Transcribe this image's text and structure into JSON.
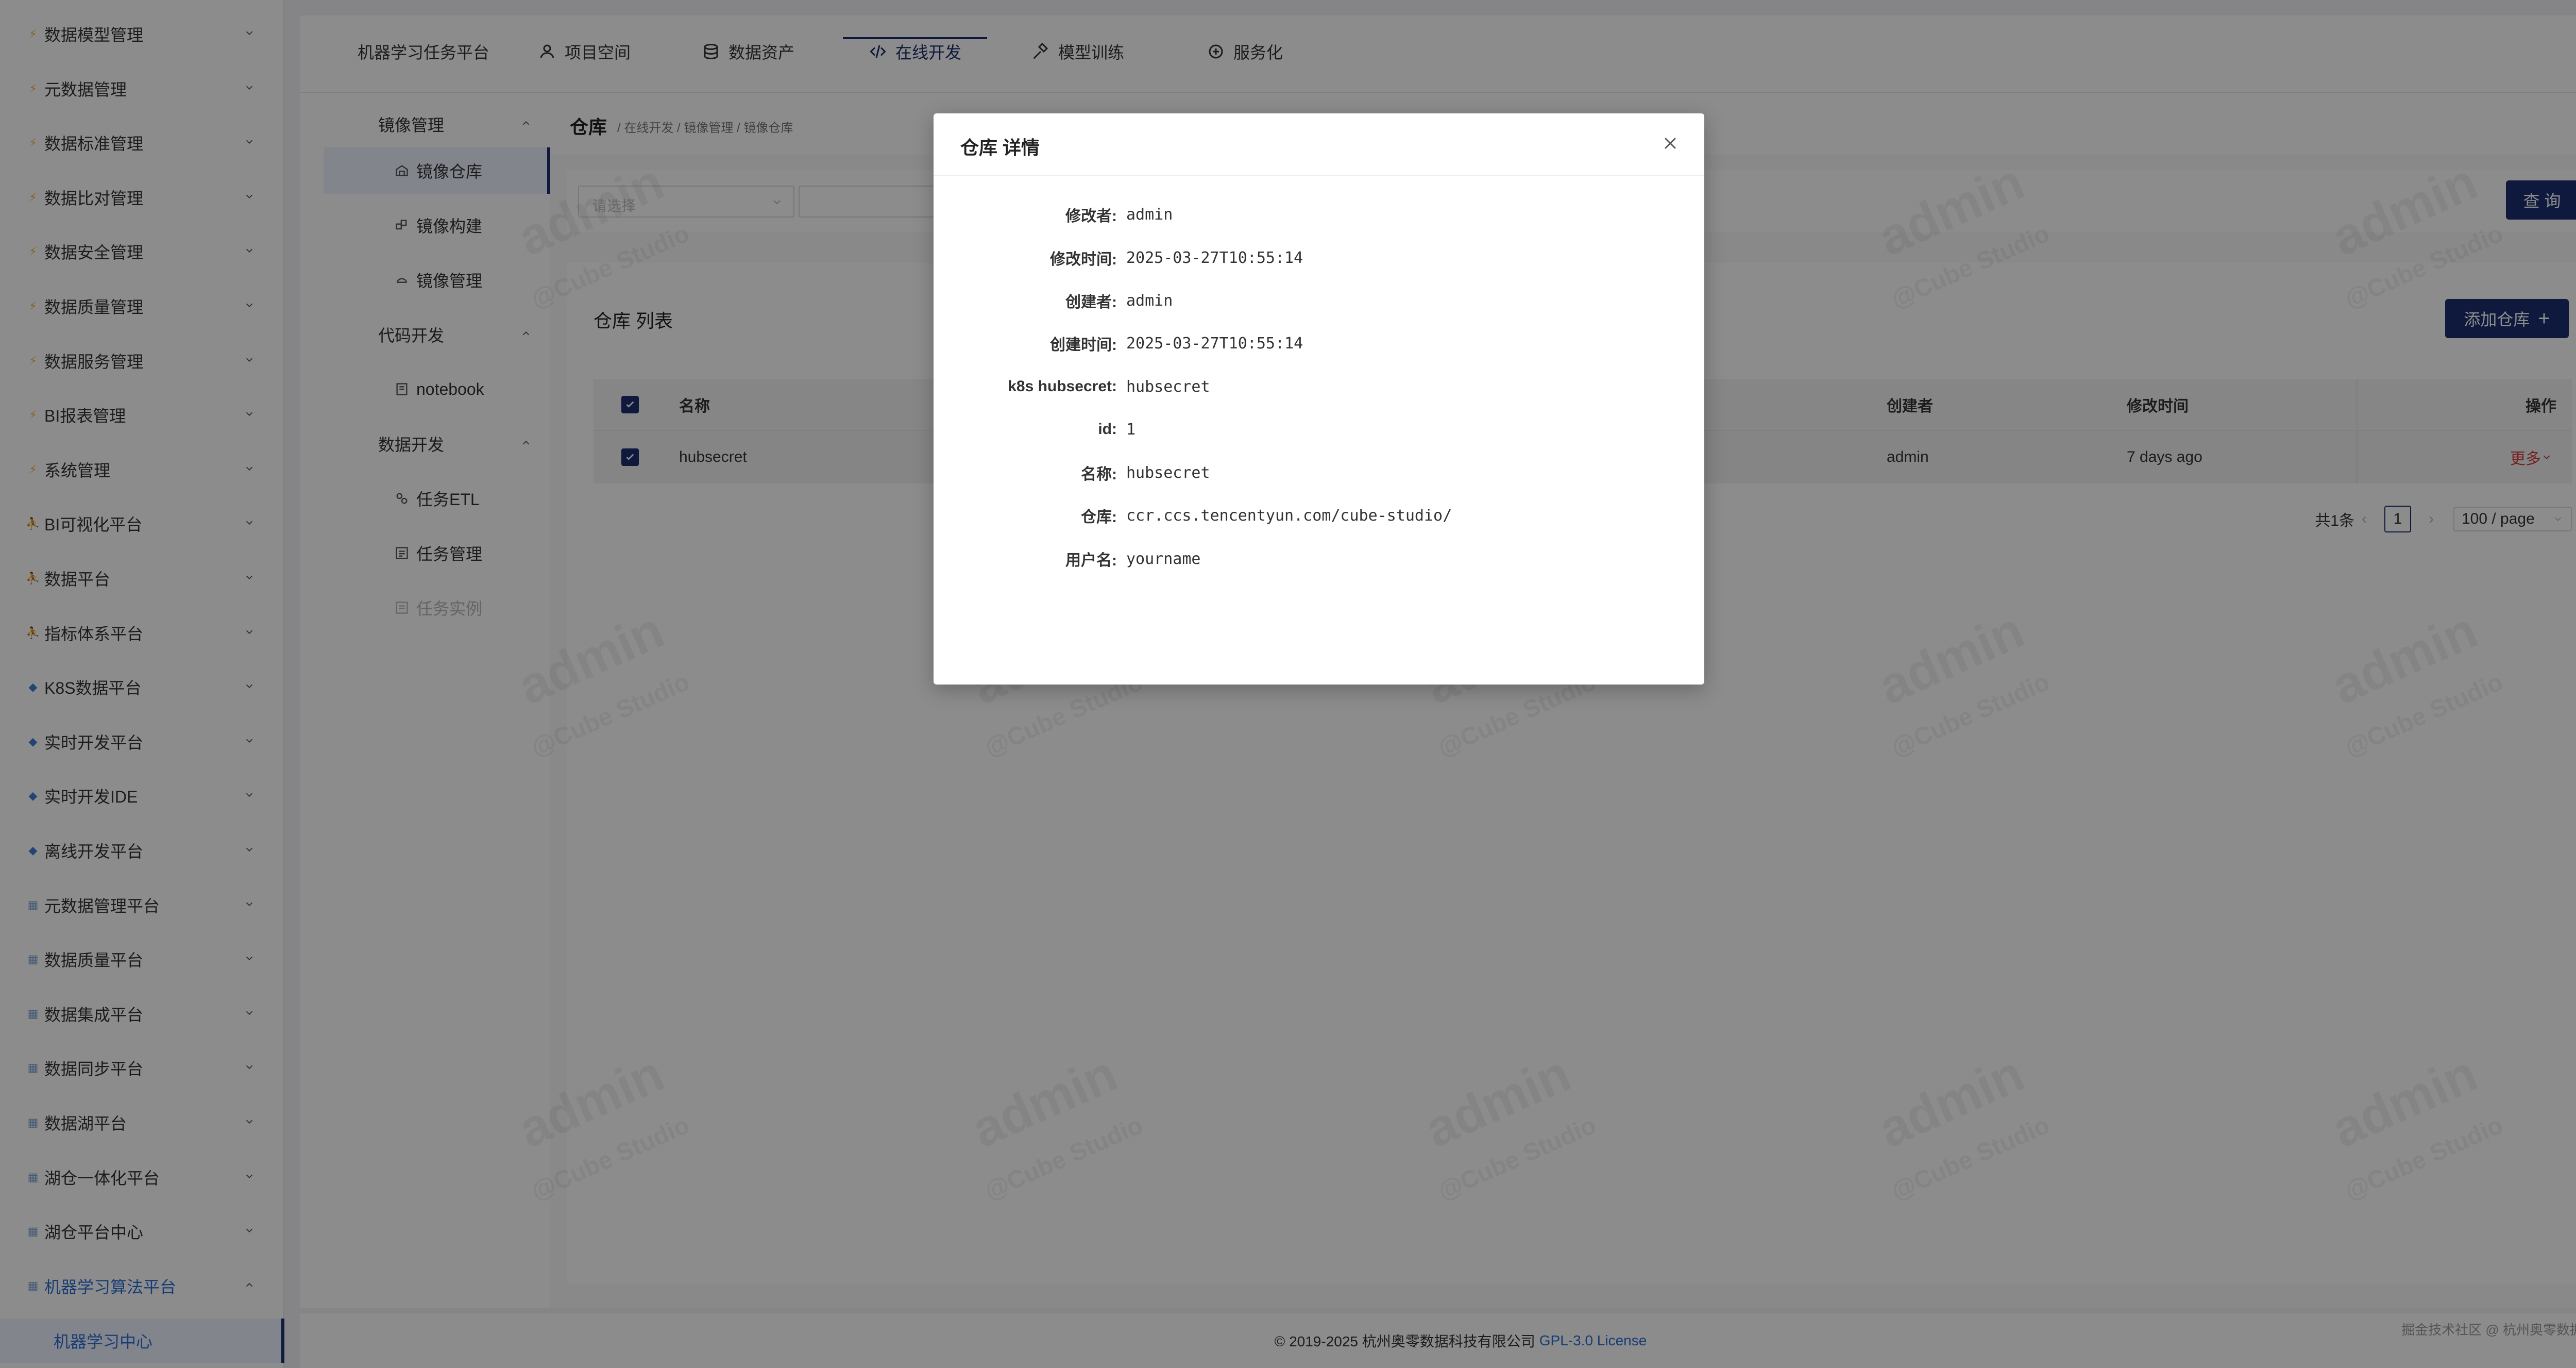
{
  "sidebar": {
    "items": [
      {
        "label": "数据模型管理",
        "icon": "bolt-icon"
      },
      {
        "label": "元数据管理",
        "icon": "bolt-icon"
      },
      {
        "label": "数据标准管理",
        "icon": "bolt-icon"
      },
      {
        "label": "数据比对管理",
        "icon": "bolt-icon"
      },
      {
        "label": "数据安全管理",
        "icon": "bolt-icon"
      },
      {
        "label": "数据质量管理",
        "icon": "bolt-icon"
      },
      {
        "label": "数据服务管理",
        "icon": "bolt-icon"
      },
      {
        "label": "BI报表管理",
        "icon": "bolt-icon"
      },
      {
        "label": "系统管理",
        "icon": "bolt-icon"
      },
      {
        "label": "BI可视化平台",
        "icon": "person-icon"
      },
      {
        "label": "数据平台",
        "icon": "person-icon"
      },
      {
        "label": "指标体系平台",
        "icon": "person-icon"
      },
      {
        "label": "K8S数据平台",
        "icon": "gem-icon"
      },
      {
        "label": "实时开发平台",
        "icon": "gem-icon"
      },
      {
        "label": "实时开发IDE",
        "icon": "gem-icon"
      },
      {
        "label": "离线开发平台",
        "icon": "gem-icon"
      },
      {
        "label": "元数据管理平台",
        "icon": "grid-icon"
      },
      {
        "label": "数据质量平台",
        "icon": "grid-icon"
      },
      {
        "label": "数据集成平台",
        "icon": "grid-icon"
      },
      {
        "label": "数据同步平台",
        "icon": "grid-icon"
      },
      {
        "label": "数据湖平台",
        "icon": "grid-icon"
      },
      {
        "label": "湖仓一体化平台",
        "icon": "grid-icon"
      },
      {
        "label": "湖仓平台中心",
        "icon": "grid-icon"
      },
      {
        "label": "机器学习算法平台",
        "icon": "grid-icon"
      }
    ],
    "active_sub": "机器学习中心"
  },
  "topnav": {
    "tabs": [
      {
        "label": "机器学习任务平台"
      },
      {
        "label": "项目空间",
        "icon": "people-icon"
      },
      {
        "label": "数据资产",
        "icon": "database-icon"
      },
      {
        "label": "在线开发",
        "icon": "code-icon"
      },
      {
        "label": "模型训练",
        "icon": "hammer-icon"
      },
      {
        "label": "服务化",
        "icon": "cloud-service-icon"
      }
    ],
    "active_index": 3
  },
  "submenu": {
    "groups": [
      {
        "label": "镜像管理",
        "items": [
          {
            "label": "镜像仓库",
            "icon": "warehouse-icon"
          },
          {
            "label": "镜像构建",
            "icon": "build-icon"
          },
          {
            "label": "镜像管理",
            "icon": "gear-sync-icon"
          }
        ]
      },
      {
        "label": "代码开发",
        "items": [
          {
            "label": "notebook",
            "icon": "notebook-icon"
          }
        ]
      },
      {
        "label": "数据开发",
        "items": [
          {
            "label": "任务ETL",
            "icon": "etl-icon"
          },
          {
            "label": "任务管理",
            "icon": "list-icon"
          },
          {
            "label": "任务实例",
            "icon": "instance-icon"
          }
        ]
      }
    ]
  },
  "content": {
    "title": "仓库",
    "breadcrumb": "/ 在线开发 / 镜像管理 / 镜像仓库",
    "filter": {
      "select_placeholder": "请选择"
    },
    "query_label": "查 询",
    "list_title": "仓库 列表",
    "add_label": "添加仓库",
    "table": {
      "headers": {
        "name": "名称",
        "creator": "创建者",
        "modified": "修改时间",
        "ops": "操作"
      },
      "rows": [
        {
          "name": "hubsecret",
          "creator": "admin",
          "modified": "7 days ago",
          "ops": "更多"
        }
      ]
    },
    "pager": {
      "total": "共1条",
      "page": "1",
      "page_size": "100 / page"
    }
  },
  "footer": {
    "copyright": "© 2019-2025 杭州奥零数据科技有限公司",
    "license": "GPL-3.0 License",
    "brand": "掘金技术社区 @ 杭州奥零数据科技"
  },
  "watermark": {
    "main": "admin",
    "sub": "@Cube Studio"
  },
  "modal": {
    "title": "仓库 详情",
    "fields": [
      {
        "label": "修改者:",
        "value": "admin"
      },
      {
        "label": "修改时间:",
        "value": "2025-03-27T10:55:14"
      },
      {
        "label": "创建者:",
        "value": "admin"
      },
      {
        "label": "创建时间:",
        "value": "2025-03-27T10:55:14"
      },
      {
        "label": "k8s hubsecret:",
        "value": "hubsecret"
      },
      {
        "label": "id:",
        "value": "1"
      },
      {
        "label": "名称:",
        "value": "hubsecret"
      },
      {
        "label": "仓库:",
        "value": "ccr.ccs.tencentyun.com/cube-studio/"
      },
      {
        "label": "用户名:",
        "value": "yourname"
      }
    ]
  }
}
